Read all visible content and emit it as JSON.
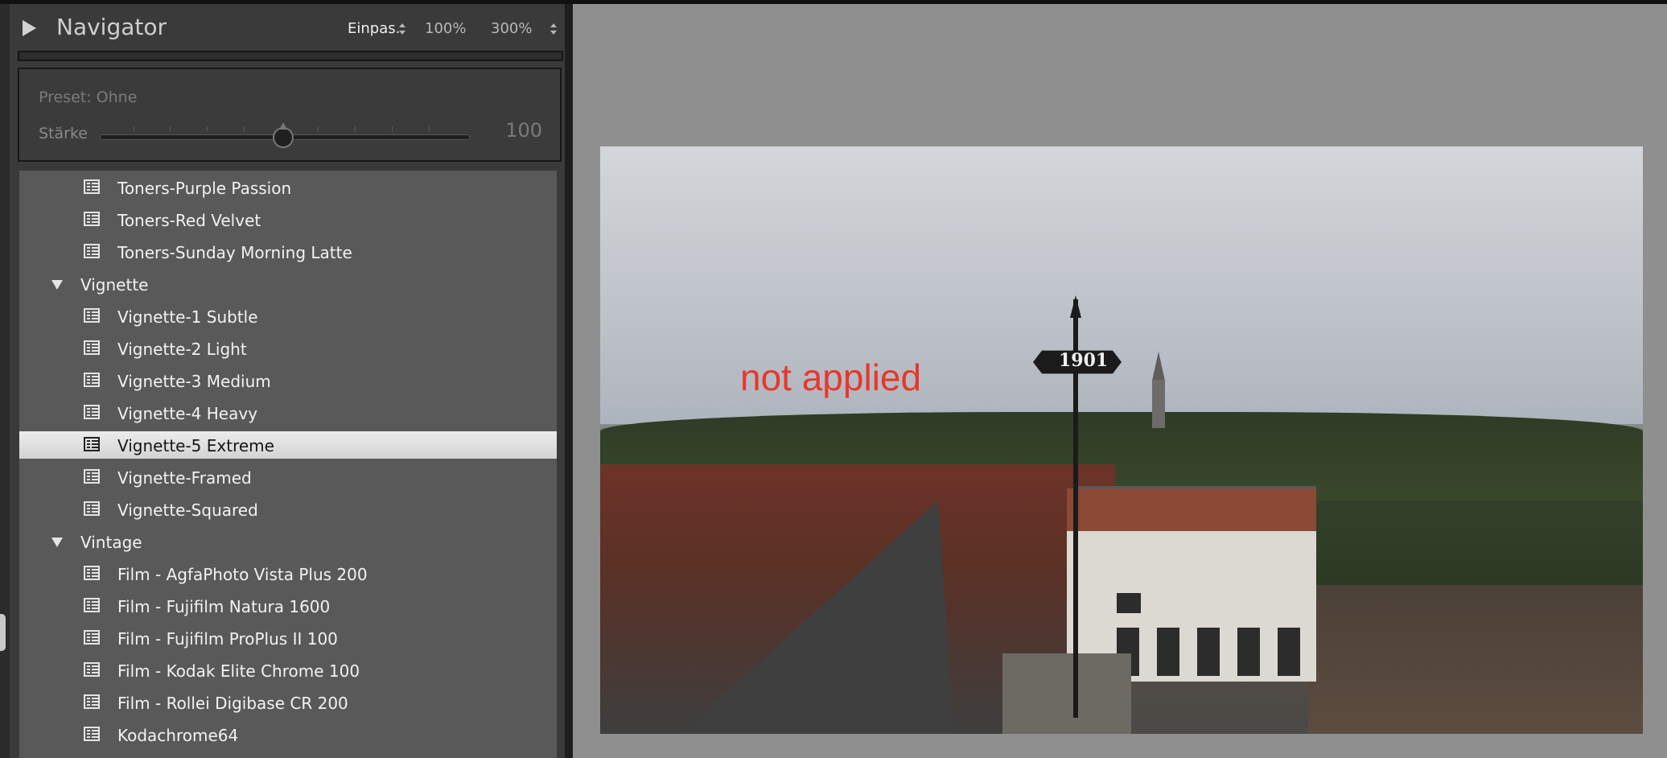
{
  "navigator": {
    "title": "Navigator",
    "zoom_fit": "Einpas.",
    "zoom_100": "100%",
    "zoom_300": "300%"
  },
  "preset_panel": {
    "preset_label": "Preset: Ohne",
    "strength_label": "Stärke",
    "strength_value": "100",
    "strength_level": 0.5
  },
  "preset_list": {
    "rows": [
      {
        "type": "item",
        "label": "Toners-Purple Passion"
      },
      {
        "type": "item",
        "label": "Toners-Red Velvet"
      },
      {
        "type": "item",
        "label": "Toners-Sunday Morning Latte"
      },
      {
        "type": "folder",
        "label": "Vignette"
      },
      {
        "type": "item",
        "label": "Vignette-1 Subtle"
      },
      {
        "type": "item",
        "label": "Vignette-2 Light"
      },
      {
        "type": "item",
        "label": "Vignette-3 Medium"
      },
      {
        "type": "item",
        "label": "Vignette-4 Heavy"
      },
      {
        "type": "item",
        "label": "Vignette-5 Extreme",
        "selected": true
      },
      {
        "type": "item",
        "label": "Vignette-Framed"
      },
      {
        "type": "item",
        "label": "Vignette-Squared"
      },
      {
        "type": "folder",
        "label": "Vintage"
      },
      {
        "type": "item",
        "label": "Film - AgfaPhoto Vista Plus 200"
      },
      {
        "type": "item",
        "label": "Film - Fujifilm Natura 1600"
      },
      {
        "type": "item",
        "label": "Film - Fujifilm ProPlus II 100"
      },
      {
        "type": "item",
        "label": "Film - Kodak Elite Chrome 100"
      },
      {
        "type": "item",
        "label": "Film - Rollei Digibase CR 200"
      },
      {
        "type": "item",
        "label": "Kodachrome64"
      }
    ]
  },
  "photo": {
    "overlay_text": "not applied",
    "overlay_color": "#e8372b",
    "vane_text": "1901"
  }
}
